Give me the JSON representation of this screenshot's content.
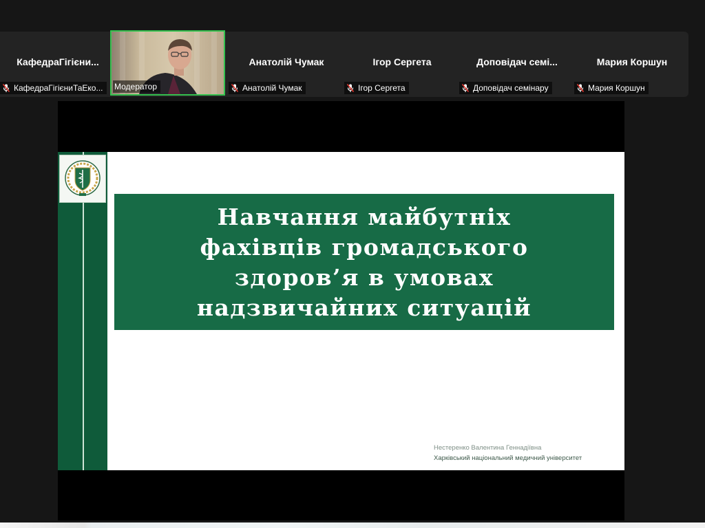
{
  "participants": [
    {
      "name": "КафедраГігієни...",
      "caption": "КафедраГігієниТаЕко..."
    },
    {
      "name": "Анатолій Чумак",
      "caption": "Анатолій Чумак"
    },
    {
      "name": "Ігор Сергета",
      "caption": "Ігор Сергета"
    },
    {
      "name": "Доповідач семі...",
      "caption": "Доповідач семінару"
    },
    {
      "name": "Мария Коршун",
      "caption": "Мария Коршун"
    }
  ],
  "active_speaker": {
    "caption": "Модератор",
    "highlight_color": "#35c24f"
  },
  "icons": {
    "mic": "mic-muted-icon",
    "logo": "university-emblem-icon"
  },
  "slide": {
    "title": "Навчання майбутніх\nфахівців громадського\nздоров’я в умовах\nнадзвичайних ситуацій",
    "author": "Нестеренко Валентина Геннадіївна",
    "institution": "Харківський національний медичний університет",
    "accent_color": "#176b46",
    "sidebar_color": "#0f5b3a"
  }
}
